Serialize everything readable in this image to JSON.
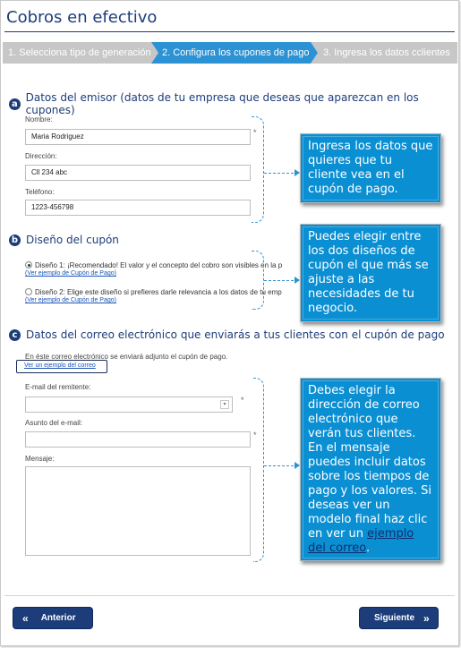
{
  "page": {
    "title": "Cobros en efectivo"
  },
  "steps": [
    {
      "label": "1. Selecciona tipo de generación"
    },
    {
      "label": "2. Configura los cupones de pago"
    },
    {
      "label": "3. Ingresa los datos cclientes"
    }
  ],
  "section_a": {
    "badge": "a",
    "title": "Datos del emisor (datos de tu empresa que deseas que aparezcan en los cupones)",
    "name_label": "Nombre:",
    "name_value": "Maria Rodriguez",
    "address_label": "Dirección:",
    "address_value": "Cll 234 abc",
    "phone_label": "Teléfono:",
    "phone_value": "1223-456798",
    "required_mark": "*"
  },
  "section_b": {
    "badge": "b",
    "title": "Diseño del cupón",
    "option1": "Diseño 1: ¡Recomendado! El valor y el concepto del cobro son visibles en la p",
    "option1_link": "(Ver ejemplo de Cupón de Pago)",
    "option2": "Diseño 2: Elige este diseño si prefieres darle relevancia a los datos de tu emp",
    "option2_link": "(Ver ejemplo de Cupón de Pago)"
  },
  "section_c": {
    "badge": "c",
    "title": "Datos del correo electrónico que enviarás a tus clientes con el cupón de pago",
    "helper": "En éste correo electrónico se enviará adjunto el cupón de pago.",
    "example_link": "Ver un ejemplo del correo",
    "sender_label": "E-mail del remitente:",
    "subject_label": "Asunto del e-mail:",
    "message_label": "Mensaje:",
    "select_arrow": "▾"
  },
  "tips": {
    "tip1": "Ingresa los datos que quieres que tu cliente vea en el cupón de pago.",
    "tip2": "Puedes elegir entre los dos diseños de cupón el que más se ajuste a las necesidades de tu negocio.",
    "tip3": "Debes elegir la dirección de correo electrónico que verán tus clientes. En el mensaje puedes incluir datos sobre los tiempos de pago y los valores. Si deseas ver un modelo final haz clic en ver un",
    "tip3_link": "ejemplo del correo",
    "tip3_end": "."
  },
  "buttons": {
    "prev_icon": "«",
    "prev_label": "Anterior",
    "next_label": "Siguiente",
    "next_icon": "»"
  },
  "colors": {
    "accent": "#2c92d3",
    "navy": "#1c3d7a",
    "tip_bg": "#0b8fd3",
    "step_inactive": "#c7c7c7"
  }
}
